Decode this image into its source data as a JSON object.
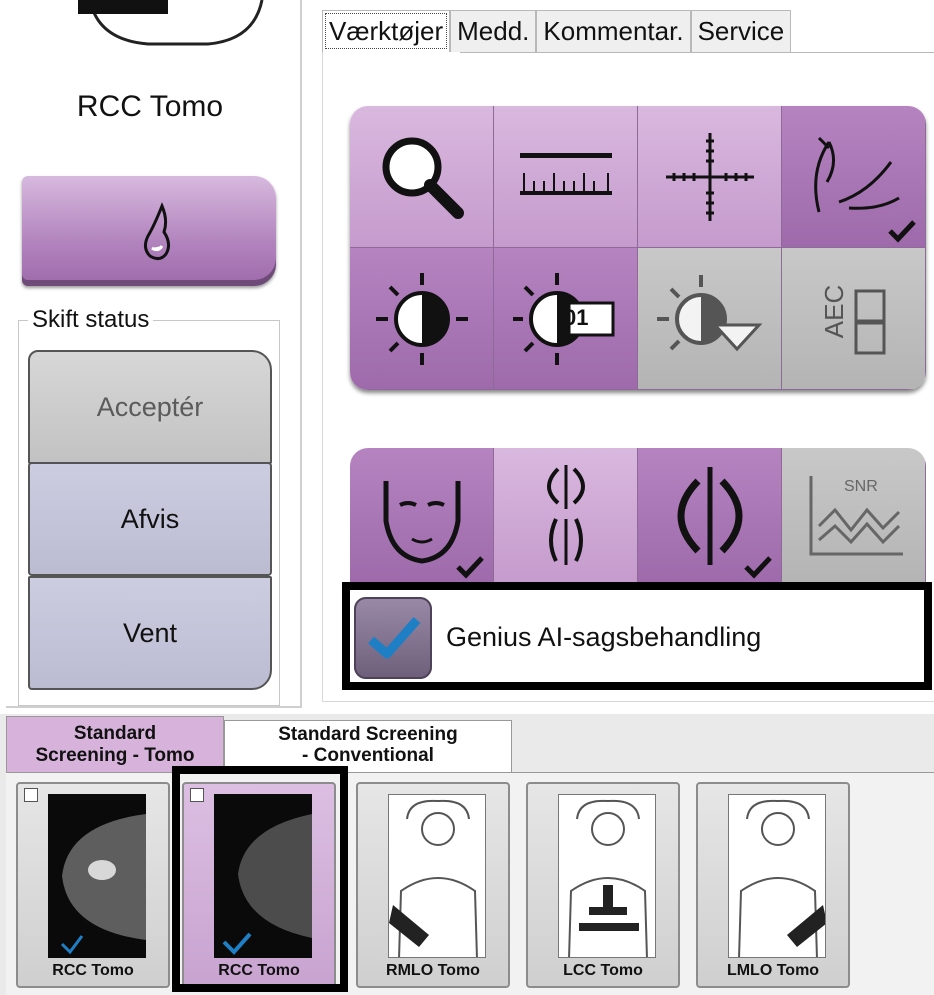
{
  "left_panel": {
    "view_label": "RCC Tomo",
    "status_group_label": "Skift status",
    "buttons": {
      "accept": "Acceptér",
      "reject": "Afvis",
      "wait": "Vent"
    }
  },
  "tabs": [
    {
      "label": "Værktøjer",
      "active": true
    },
    {
      "label": "Medd."
    },
    {
      "label": "Kommentar."
    },
    {
      "label": "Service"
    }
  ],
  "tools": {
    "ct_toggle_label": "01",
    "aec_label": "AEC",
    "snr_label": "SNR"
  },
  "ai_option": {
    "label": "Genius AI-sagsbehandling",
    "checked": true
  },
  "bottom_tabs": [
    {
      "label_line1": "Standard",
      "label_line2": "Screening - Tomo",
      "active": true
    },
    {
      "label_line1": "Standard Screening",
      "label_line2": "- Conventional"
    }
  ],
  "thumbnails": [
    {
      "label": "RCC Tomo",
      "checked": true
    },
    {
      "label": "RCC Tomo",
      "checked": true,
      "selected": true
    },
    {
      "label": "RMLO Tomo"
    },
    {
      "label": "LCC Tomo"
    },
    {
      "label": "LMLO Tomo"
    }
  ],
  "colors": {
    "accent_purple": "#b284be",
    "dark_purple": "#9e6aab",
    "check_blue": "#1e7fc4"
  }
}
